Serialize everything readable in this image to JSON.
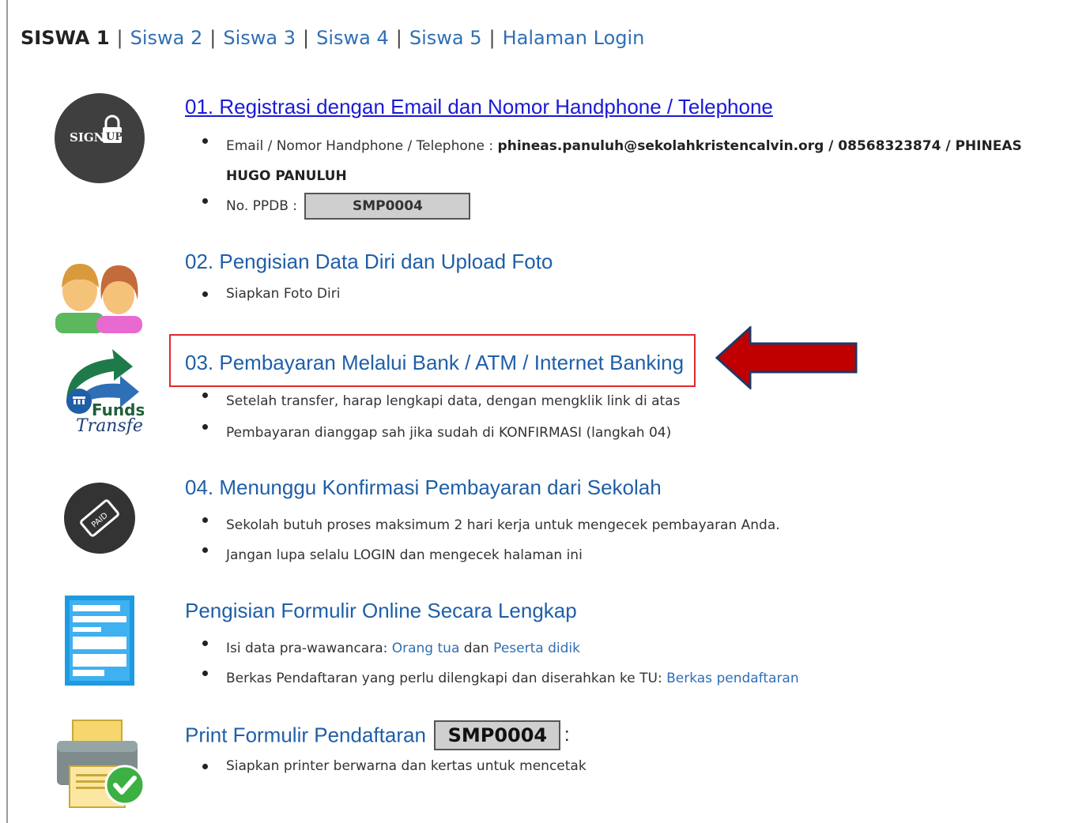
{
  "nav": {
    "current": "SISWA 1",
    "separator": "|",
    "links": [
      "Siswa 2",
      "Siswa 3",
      "Siswa 4",
      "Siswa 5",
      "Halaman Login"
    ]
  },
  "step1": {
    "title": "01. Registrasi dengan Email dan Nomor Handphone / Telephone",
    "email_label": "Email / Nomor Handphone / Telephone :",
    "email_value": "phineas.panuluh@sekolahkristencalvin.org / 08568323874 / PHINEAS",
    "email_value_cont": "HUGO PANULUH",
    "ppdb_label": "No. PPDB :",
    "ppdb_value": "SMP0004",
    "icon_text_sign": "SIGN",
    "icon_text_up": "UP"
  },
  "step2": {
    "title": "02. Pengisian Data Diri dan Upload Foto",
    "bullet1": "Siapkan Foto Diri"
  },
  "step3": {
    "title": "03. Pembayaran Melalui Bank / ATM / Internet Banking",
    "bullet1": "Setelah transfer, harap lengkapi data, dengan mengklik link di atas",
    "bullet2": "Pembayaran dianggap sah jika sudah di KONFIRMASI (langkah 04)",
    "icon_text_funds": "Funds",
    "icon_text_transfer": "Transfer"
  },
  "step4": {
    "title": "04. Menunggu Konfirmasi Pembayaran dari Sekolah",
    "bullet1": "Sekolah butuh proses maksimum 2 hari kerja untuk mengecek pembayaran Anda.",
    "bullet2": "Jangan lupa selalu LOGIN dan mengecek halaman ini",
    "icon_text": "PAID"
  },
  "step5": {
    "title": "Pengisian Formulir Online Secara Lengkap",
    "bullet1_prefix": "Isi data pra-wawancara:",
    "bullet1_link1": "Orang tua",
    "bullet1_and": "dan",
    "bullet1_link2": "Peserta didik",
    "bullet2_prefix": "Berkas Pendaftaran yang perlu dilengkapi dan diserahkan ke TU:",
    "bullet2_link": "Berkas pendaftaran"
  },
  "step6": {
    "title": "Print Formulir Pendaftaran",
    "code": "SMP0004",
    "colon": ":",
    "bullet1": "Siapkan printer berwarna dan kertas untuk mencetak"
  },
  "colors": {
    "link": "#2f6fb5",
    "highlight_border": "#e0282a",
    "arrow_fill": "#c00000",
    "arrow_stroke": "#1f3864"
  }
}
